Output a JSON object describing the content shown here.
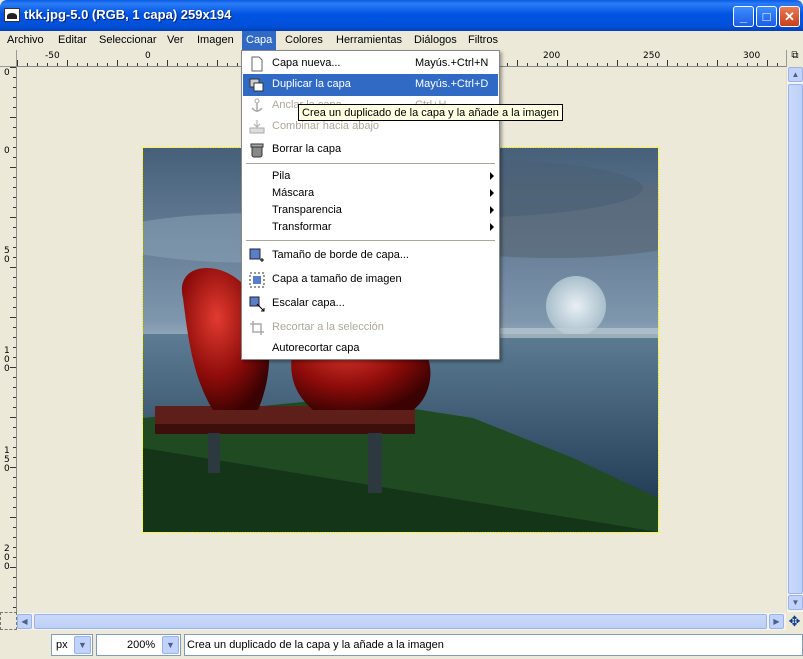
{
  "window": {
    "title": "tkk.jpg-5.0 (RGB, 1 capa) 259x194",
    "minimize_glyph": "_",
    "maximize_glyph": "□",
    "close_glyph": "✕"
  },
  "menubar": {
    "items": [
      "Archivo",
      "Editar",
      "Seleccionar",
      "Ver",
      "Imagen",
      "Capa",
      "Colores",
      "Herramientas",
      "Diálogos",
      "Filtros"
    ],
    "active": "Capa"
  },
  "rulers": {
    "horizontal_labels": [
      "-50",
      "0",
      "200",
      "250",
      "300"
    ],
    "vertical_labels": [
      "0",
      "0",
      "50",
      "100",
      "150",
      "200"
    ]
  },
  "layer_menu": {
    "items": [
      {
        "label": "Capa nueva...",
        "shortcut": "Mayús.+Ctrl+N",
        "icon": "new-layer-icon",
        "state": "normal"
      },
      {
        "label": "Duplicar la capa",
        "shortcut": "Mayús.+Ctrl+D",
        "icon": "duplicate-layer-icon",
        "state": "highlight"
      },
      {
        "label": "Anclar la capa",
        "shortcut": "Ctrl+H",
        "icon": "anchor-icon",
        "state": "disabled"
      },
      {
        "label": "Combinar hacia abajo",
        "shortcut": "",
        "icon": "merge-down-icon",
        "state": "disabled"
      },
      {
        "label": "Borrar la capa",
        "shortcut": "",
        "icon": "delete-layer-icon",
        "state": "normal"
      },
      {
        "label": "Pila",
        "submenu": true,
        "state": "normal"
      },
      {
        "label": "Máscara",
        "submenu": true,
        "state": "normal"
      },
      {
        "label": "Transparencia",
        "submenu": true,
        "state": "normal"
      },
      {
        "label": "Transformar",
        "submenu": true,
        "state": "normal"
      },
      {
        "label": "Tamaño de borde de capa...",
        "icon": "layer-boundary-icon",
        "state": "normal"
      },
      {
        "label": "Capa a tamaño de imagen",
        "icon": "layer-to-image-size-icon",
        "state": "normal"
      },
      {
        "label": "Escalar capa...",
        "icon": "scale-layer-icon",
        "state": "normal"
      },
      {
        "label": "Recortar a la selección",
        "icon": "crop-icon",
        "state": "disabled"
      },
      {
        "label": "Autorecortar capa",
        "icon": "",
        "state": "normal"
      }
    ]
  },
  "tooltip": "Crea un duplicado de la capa y la añade a la imagen",
  "statusbar": {
    "unit": "px",
    "zoom": "200%",
    "message": "Crea un duplicado de la capa y la añade a la imagen"
  },
  "colors": {
    "titlebar": "#0054e3",
    "menu_highlight": "#316ac5",
    "tooltip_bg": "#ffffe1",
    "window_bg": "#ece9d8"
  }
}
